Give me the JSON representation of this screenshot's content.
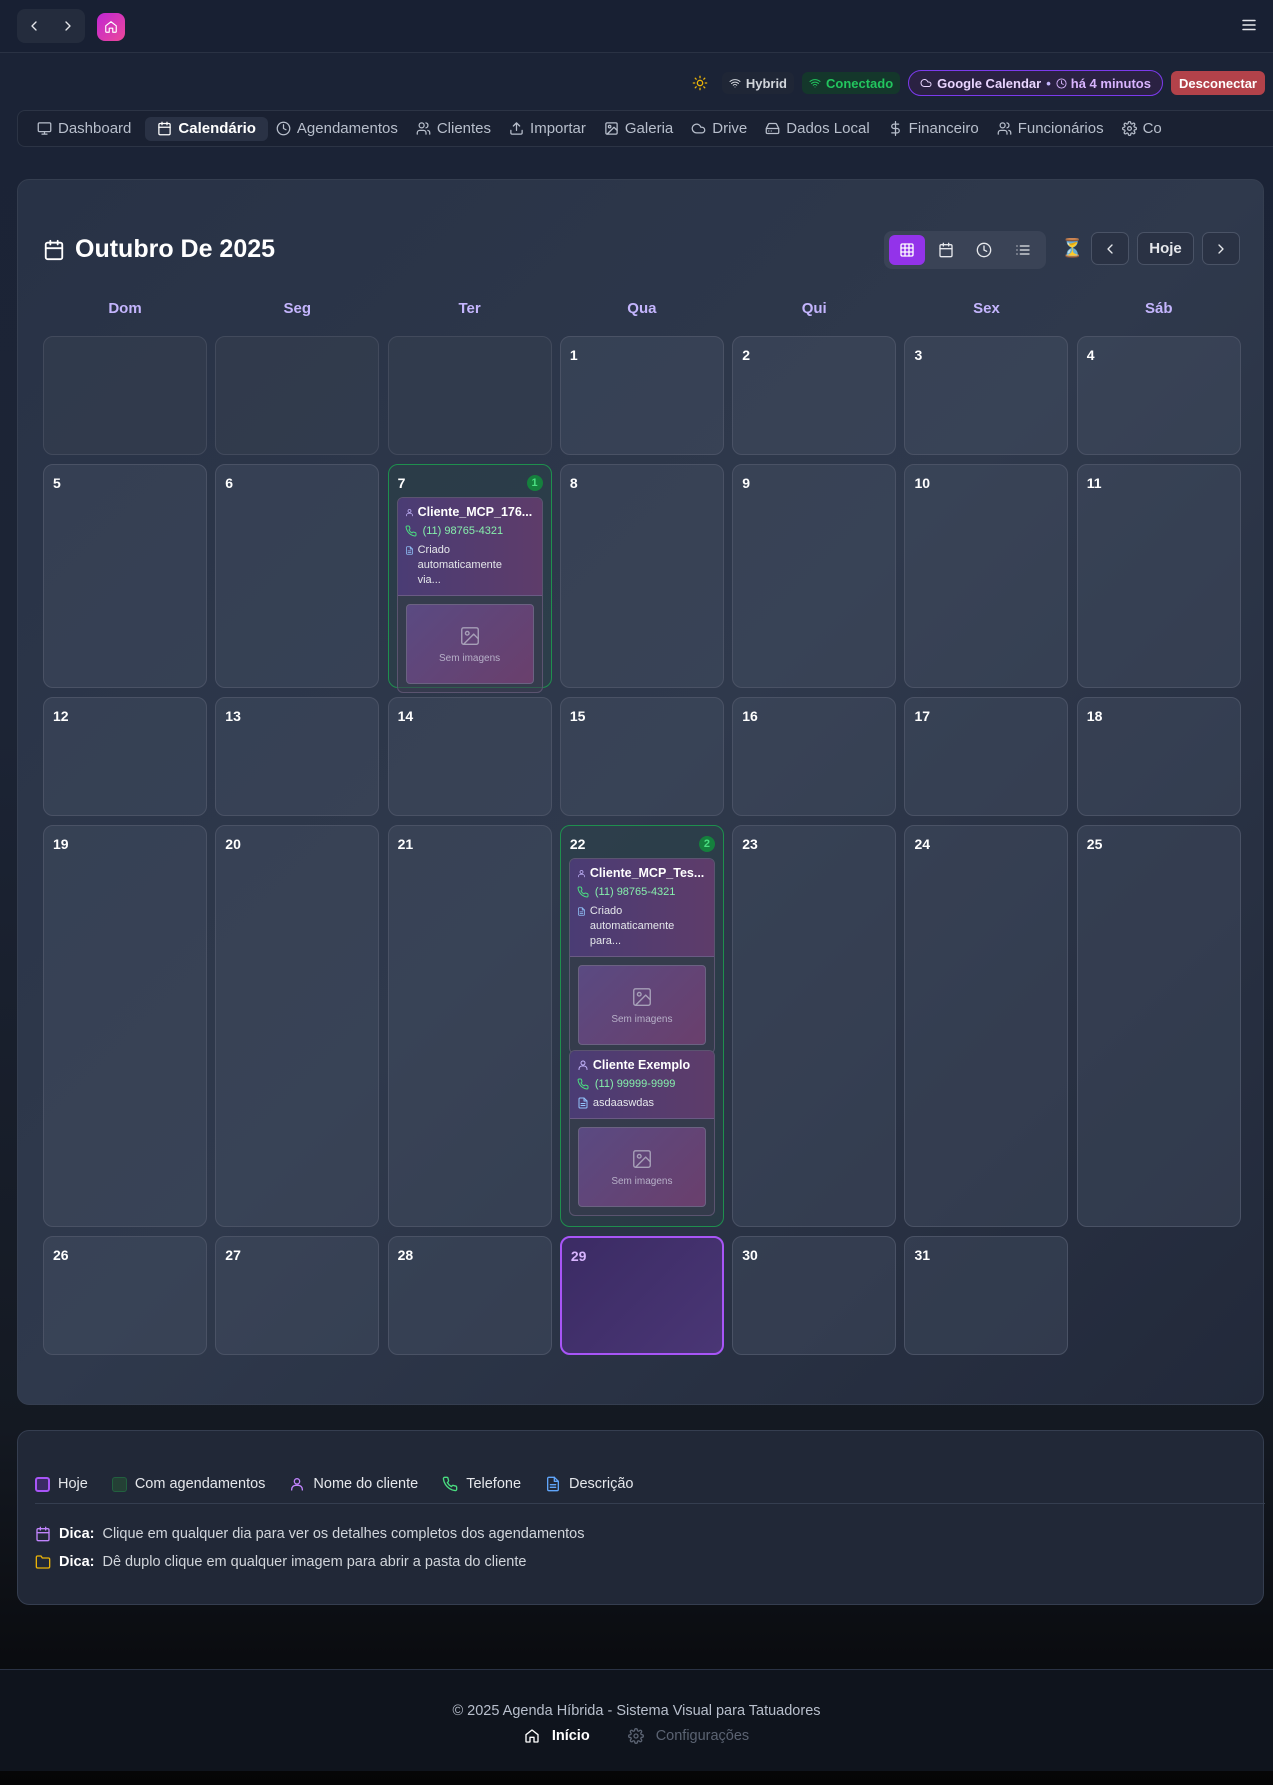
{
  "header": {
    "back_icon": "chevron-left-icon",
    "forward_icon": "chevron-right-icon",
    "app_icon": "home-icon",
    "menu_icon": "hamburger-menu-icon"
  },
  "status": {
    "mode": "Hybrid",
    "connection": "Conectado",
    "service": "Google Calendar",
    "separator": "•",
    "sync_time": "há 4 minutos",
    "disconnect": "Desconectar",
    "colors": {
      "connected": "#22c55e",
      "disconnect_bg": "#b3424a",
      "accent": "#9333ea"
    }
  },
  "tabs": [
    {
      "label": "Dashboard",
      "icon": "monitor-icon"
    },
    {
      "label": "Calendário",
      "icon": "calendar-icon",
      "active": true
    },
    {
      "label": "Agendamentos",
      "icon": "clock-icon"
    },
    {
      "label": "Clientes",
      "icon": "users-icon"
    },
    {
      "label": "Importar",
      "icon": "upload-icon"
    },
    {
      "label": "Galeria",
      "icon": "image-icon"
    },
    {
      "label": "Drive",
      "icon": "cloud-icon"
    },
    {
      "label": "Dados Local",
      "icon": "hard-drive-icon"
    },
    {
      "label": "Financeiro",
      "icon": "dollar-icon"
    },
    {
      "label": "Funcionários",
      "icon": "users-icon"
    },
    {
      "label": "Co",
      "icon": "gear-icon"
    }
  ],
  "calendar": {
    "title": "Outubro De 2025",
    "today_button": "Hoje",
    "weekdays": [
      "Dom",
      "Seg",
      "Ter",
      "Qua",
      "Qui",
      "Sex",
      "Sáb"
    ],
    "today_day": "29",
    "days": {
      "d1": "1",
      "d2": "2",
      "d3": "3",
      "d4": "4",
      "d5": "5",
      "d6": "6",
      "d7": "7",
      "d8": "8",
      "d9": "9",
      "d10": "10",
      "d11": "11",
      "d12": "12",
      "d13": "13",
      "d14": "14",
      "d15": "15",
      "d16": "16",
      "d17": "17",
      "d18": "18",
      "d19": "19",
      "d20": "20",
      "d21": "21",
      "d22": "22",
      "d23": "23",
      "d24": "24",
      "d25": "25",
      "d26": "26",
      "d27": "27",
      "d28": "28",
      "d29": "29",
      "d30": "30",
      "d31": "31"
    },
    "counts": {
      "d7": "1",
      "d22": "2"
    },
    "appointments": {
      "a7": {
        "client": "Cliente_MCP_176...",
        "phone": "(11) 98765-4321",
        "desc_1": "Criado",
        "desc_2": "automaticamente via...",
        "no_images": "Sem imagens"
      },
      "a22a": {
        "client": "Cliente_MCP_Tes...",
        "phone": "(11) 98765-4321",
        "desc_1": "Criado",
        "desc_2": "automaticamente para...",
        "no_images": "Sem imagens"
      },
      "a22b": {
        "client": "Cliente Exemplo",
        "phone": "(11) 99999-9999",
        "desc_1": "asdaaswdas",
        "no_images": "Sem imagens"
      }
    }
  },
  "legend": {
    "today": "Hoje",
    "with_appointments": "Com agendamentos",
    "client_name": "Nome do cliente",
    "phone": "Telefone",
    "description": "Descrição",
    "tip_label": "Dica:",
    "tip1": "Clique em qualquer dia para ver os detalhes completos dos agendamentos",
    "tip2": "Dê duplo clique em qualquer imagem para abrir a pasta do cliente"
  },
  "footer": {
    "copyright": "© 2025 Agenda Híbrida - Sistema Visual para Tatuadores",
    "home": "Início",
    "settings": "Configurações"
  }
}
